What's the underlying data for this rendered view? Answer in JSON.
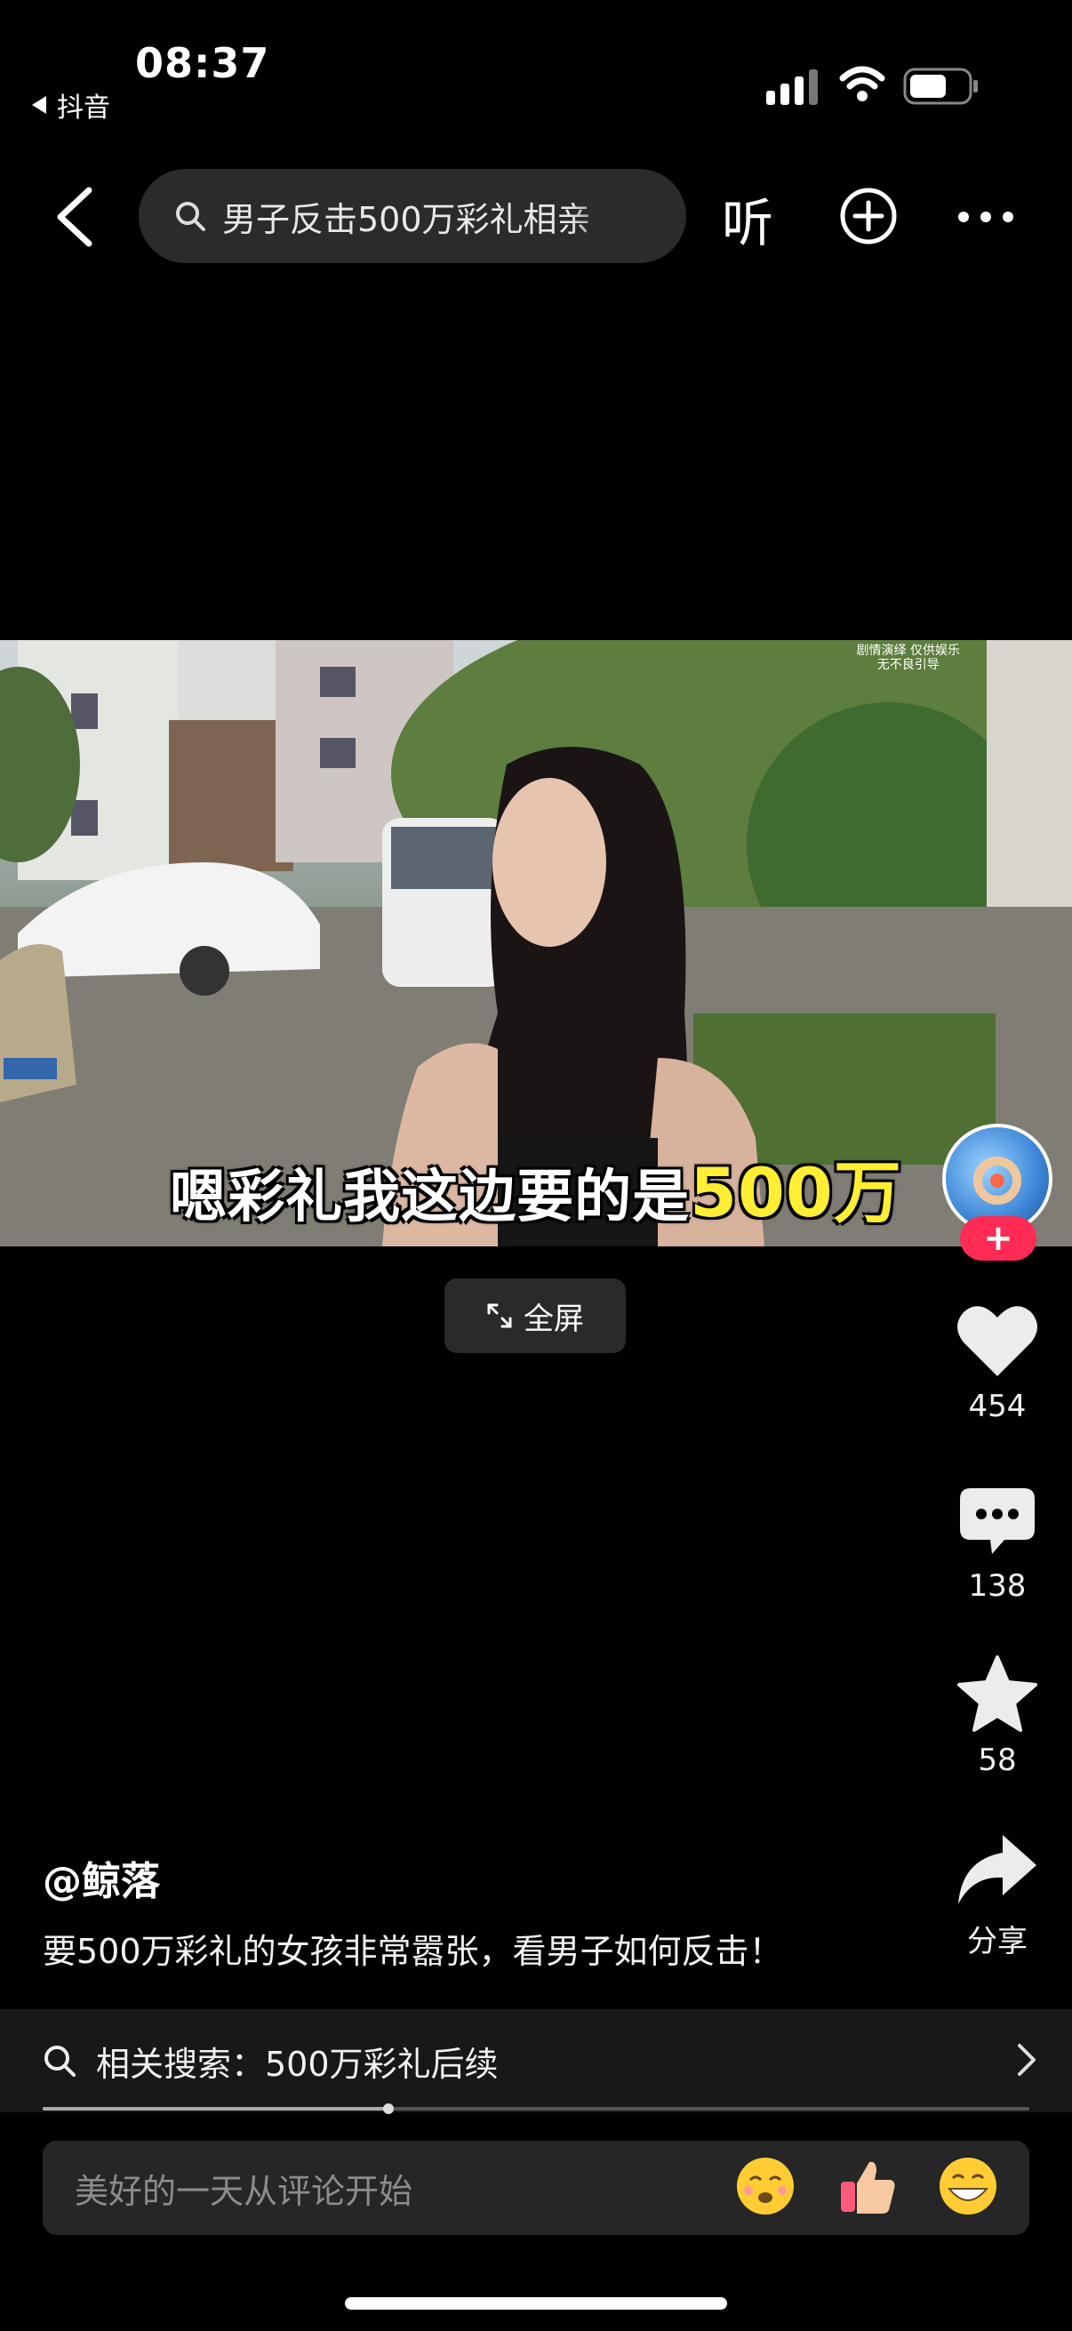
{
  "status_bar": {
    "time": "08:37",
    "back_app": "抖音"
  },
  "nav": {
    "search_text": "男子反击500万彩礼相亲",
    "listen_label": "听"
  },
  "video": {
    "subtitle_prefix": "嗯彩礼我这边要的是",
    "subtitle_highlight": "500万",
    "watermark_line1": "剧情演绎 仅供娱乐",
    "watermark_line2": "无不良引导"
  },
  "fullscreen_label": "全屏",
  "actions": {
    "likes": "454",
    "comments": "138",
    "favorites": "58",
    "share_label": "分享"
  },
  "post": {
    "author": "@鲸落",
    "description": "要500万彩礼的女孩非常嚣张，看男子如何反击！"
  },
  "related_search": {
    "text": "相关搜索：500万彩礼后续"
  },
  "progress": {
    "fraction": 0.35
  },
  "comment_input": {
    "placeholder": "美好的一天从评论开始"
  },
  "icons": [
    "back-icon",
    "search-icon",
    "plus-circle-icon",
    "more-icon",
    "heart-icon",
    "comment-icon",
    "star-icon",
    "share-icon",
    "chevron-right-icon"
  ],
  "colors": {
    "accent": "#fe2c55",
    "background": "#000000",
    "subtitle_highlight": "#ffee33"
  }
}
